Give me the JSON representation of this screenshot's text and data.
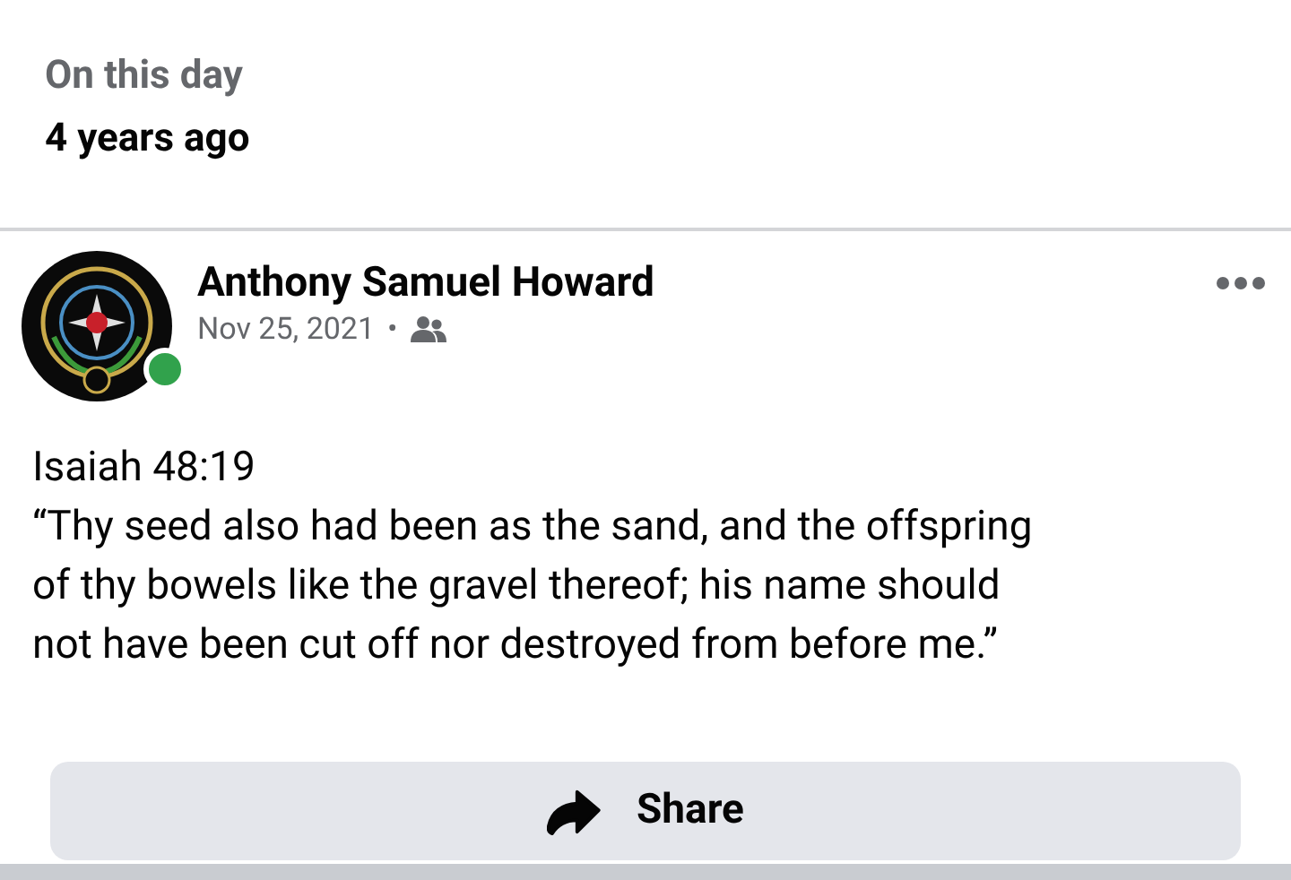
{
  "memory": {
    "label": "On this day",
    "ago": "4 years ago"
  },
  "post": {
    "author": "Anthony Samuel Howard",
    "online": true,
    "date": "Nov 25, 2021",
    "separator": "•",
    "lines": [
      "Isaiah 48:19",
      "“Thy seed also had been as the sand, and the offspring",
      "of thy bowels like the gravel thereof; his name should",
      "not have been cut off nor destroyed from before me.”"
    ]
  },
  "share": {
    "label": "Share"
  }
}
